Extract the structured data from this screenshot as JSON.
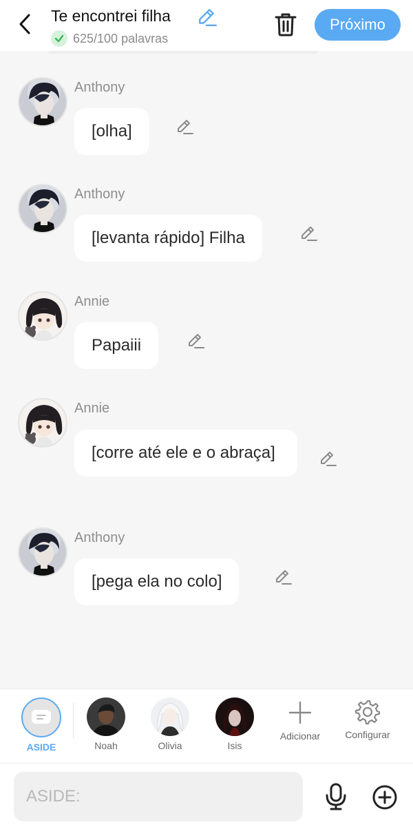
{
  "header": {
    "title": "Te encontrei filha",
    "word_count": "625/100 palavras",
    "next_label": "Próximo"
  },
  "messages": [
    {
      "sender": "Anthony",
      "text": "[olha]",
      "avatar_icon": "anthony-avatar"
    },
    {
      "sender": "Anthony",
      "text": "[levanta rápido] Filha",
      "avatar_icon": "anthony-avatar"
    },
    {
      "sender": "Annie",
      "text": "Papaiii",
      "avatar_icon": "annie-avatar"
    },
    {
      "sender": "Annie",
      "text": "[corre até ele e o abraça]",
      "avatar_icon": "annie-avatar"
    },
    {
      "sender": "Anthony",
      "text": "[pega ela no colo]",
      "avatar_icon": "anthony-avatar"
    }
  ],
  "characters": [
    {
      "label": "ASIDE",
      "selected": true
    },
    {
      "label": "Noah"
    },
    {
      "label": "Olivia"
    },
    {
      "label": "Isis"
    }
  ],
  "actions": {
    "add_label": "Adicionar",
    "settings_label": "Configurar"
  },
  "input": {
    "placeholder": "ASIDE:"
  },
  "colors": {
    "accent": "#5aaaf3",
    "background": "#f6f6f6",
    "bubble": "#ffffff",
    "check_green": "#3bb55b"
  }
}
